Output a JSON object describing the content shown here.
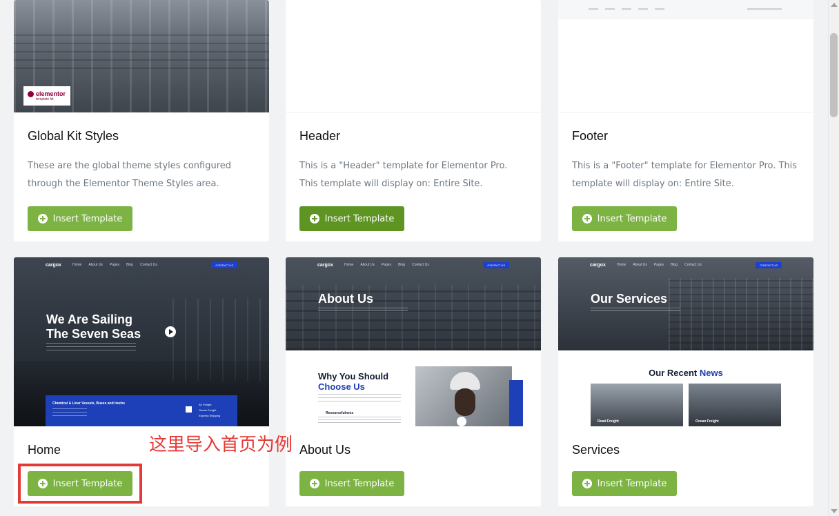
{
  "cards": [
    {
      "title": "Global Kit Styles",
      "description": "These are the global theme styles configured through the Elementor Theme Styles area.",
      "button": "Insert Template",
      "badge_brand": "elementor",
      "badge_sub": "template kit"
    },
    {
      "title": "Header",
      "description": "This is a \"Header\" template for Elementor Pro. This template will display on: Entire Site.",
      "button": "Insert Template"
    },
    {
      "title": "Footer",
      "description": "This is a \"Footer\" template for Elementor Pro. This template will display on: Entire Site.",
      "button": "Insert Template"
    },
    {
      "title": "Home",
      "button": "Insert Template",
      "preview": {
        "logo": "cargox",
        "nav": [
          "Home",
          "About Us",
          "Pages",
          "Blog",
          "Contact Us"
        ],
        "cta": "CONTACT US",
        "hero_line1": "We Are Sailing",
        "hero_line2": "The Seven Seas",
        "band_title": "Chemical & Liner Vessels, Buses and trucks",
        "band_items": [
          "Air Freight",
          "Ocean Freight",
          "Express Shipping"
        ]
      }
    },
    {
      "title": "About Us",
      "button": "Insert Template",
      "preview": {
        "logo": "cargox",
        "nav": [
          "Home",
          "About Us",
          "Pages",
          "Blog",
          "Contact Us"
        ],
        "cta": "CONTACT US",
        "hero": "About Us",
        "section_line1": "Why You Should",
        "section_line2": "Choose Us",
        "feature": "Resourcefulness"
      }
    },
    {
      "title": "Services",
      "button": "Insert Template",
      "preview": {
        "logo": "cargox",
        "nav": [
          "Home",
          "About Us",
          "Pages",
          "Blog",
          "Contact Us"
        ],
        "cta": "CONTACT US",
        "hero": "Our Services",
        "news_prefix": "Our Recent",
        "news_word": "News",
        "news_items": [
          "Road Freight",
          "Ocean Freight"
        ]
      }
    }
  ],
  "annotation": "这里导入首页为例",
  "colors": {
    "button": "#7cb342",
    "button_active": "#5d9422",
    "annotation": "#e53935",
    "accent_blue": "#1d3fb8"
  }
}
